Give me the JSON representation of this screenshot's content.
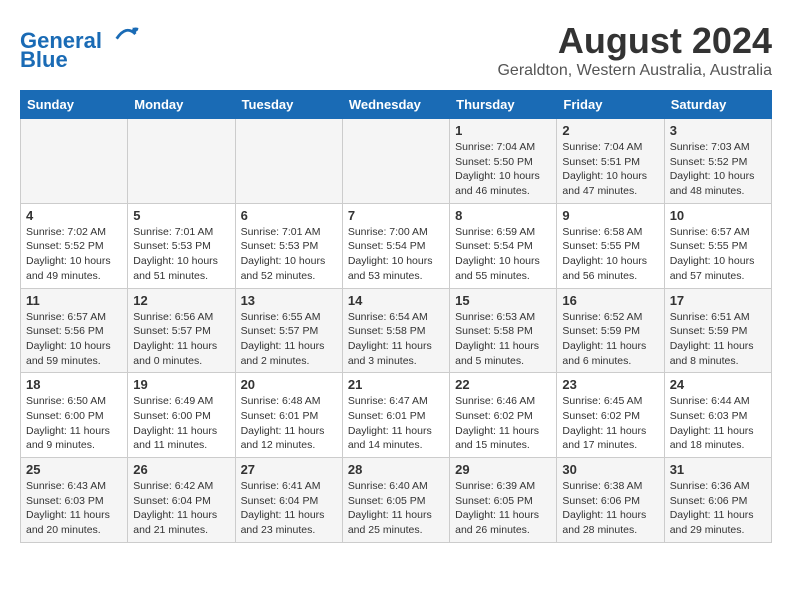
{
  "logo": {
    "line1": "General",
    "line2": "Blue"
  },
  "title": "August 2024",
  "subtitle": "Geraldton, Western Australia, Australia",
  "days_of_week": [
    "Sunday",
    "Monday",
    "Tuesday",
    "Wednesday",
    "Thursday",
    "Friday",
    "Saturday"
  ],
  "weeks": [
    [
      {
        "day": "",
        "info": ""
      },
      {
        "day": "",
        "info": ""
      },
      {
        "day": "",
        "info": ""
      },
      {
        "day": "",
        "info": ""
      },
      {
        "day": "1",
        "info": "Sunrise: 7:04 AM\nSunset: 5:50 PM\nDaylight: 10 hours and 46 minutes."
      },
      {
        "day": "2",
        "info": "Sunrise: 7:04 AM\nSunset: 5:51 PM\nDaylight: 10 hours and 47 minutes."
      },
      {
        "day": "3",
        "info": "Sunrise: 7:03 AM\nSunset: 5:52 PM\nDaylight: 10 hours and 48 minutes."
      }
    ],
    [
      {
        "day": "4",
        "info": "Sunrise: 7:02 AM\nSunset: 5:52 PM\nDaylight: 10 hours and 49 minutes."
      },
      {
        "day": "5",
        "info": "Sunrise: 7:01 AM\nSunset: 5:53 PM\nDaylight: 10 hours and 51 minutes."
      },
      {
        "day": "6",
        "info": "Sunrise: 7:01 AM\nSunset: 5:53 PM\nDaylight: 10 hours and 52 minutes."
      },
      {
        "day": "7",
        "info": "Sunrise: 7:00 AM\nSunset: 5:54 PM\nDaylight: 10 hours and 53 minutes."
      },
      {
        "day": "8",
        "info": "Sunrise: 6:59 AM\nSunset: 5:54 PM\nDaylight: 10 hours and 55 minutes."
      },
      {
        "day": "9",
        "info": "Sunrise: 6:58 AM\nSunset: 5:55 PM\nDaylight: 10 hours and 56 minutes."
      },
      {
        "day": "10",
        "info": "Sunrise: 6:57 AM\nSunset: 5:55 PM\nDaylight: 10 hours and 57 minutes."
      }
    ],
    [
      {
        "day": "11",
        "info": "Sunrise: 6:57 AM\nSunset: 5:56 PM\nDaylight: 10 hours and 59 minutes."
      },
      {
        "day": "12",
        "info": "Sunrise: 6:56 AM\nSunset: 5:57 PM\nDaylight: 11 hours and 0 minutes."
      },
      {
        "day": "13",
        "info": "Sunrise: 6:55 AM\nSunset: 5:57 PM\nDaylight: 11 hours and 2 minutes."
      },
      {
        "day": "14",
        "info": "Sunrise: 6:54 AM\nSunset: 5:58 PM\nDaylight: 11 hours and 3 minutes."
      },
      {
        "day": "15",
        "info": "Sunrise: 6:53 AM\nSunset: 5:58 PM\nDaylight: 11 hours and 5 minutes."
      },
      {
        "day": "16",
        "info": "Sunrise: 6:52 AM\nSunset: 5:59 PM\nDaylight: 11 hours and 6 minutes."
      },
      {
        "day": "17",
        "info": "Sunrise: 6:51 AM\nSunset: 5:59 PM\nDaylight: 11 hours and 8 minutes."
      }
    ],
    [
      {
        "day": "18",
        "info": "Sunrise: 6:50 AM\nSunset: 6:00 PM\nDaylight: 11 hours and 9 minutes."
      },
      {
        "day": "19",
        "info": "Sunrise: 6:49 AM\nSunset: 6:00 PM\nDaylight: 11 hours and 11 minutes."
      },
      {
        "day": "20",
        "info": "Sunrise: 6:48 AM\nSunset: 6:01 PM\nDaylight: 11 hours and 12 minutes."
      },
      {
        "day": "21",
        "info": "Sunrise: 6:47 AM\nSunset: 6:01 PM\nDaylight: 11 hours and 14 minutes."
      },
      {
        "day": "22",
        "info": "Sunrise: 6:46 AM\nSunset: 6:02 PM\nDaylight: 11 hours and 15 minutes."
      },
      {
        "day": "23",
        "info": "Sunrise: 6:45 AM\nSunset: 6:02 PM\nDaylight: 11 hours and 17 minutes."
      },
      {
        "day": "24",
        "info": "Sunrise: 6:44 AM\nSunset: 6:03 PM\nDaylight: 11 hours and 18 minutes."
      }
    ],
    [
      {
        "day": "25",
        "info": "Sunrise: 6:43 AM\nSunset: 6:03 PM\nDaylight: 11 hours and 20 minutes."
      },
      {
        "day": "26",
        "info": "Sunrise: 6:42 AM\nSunset: 6:04 PM\nDaylight: 11 hours and 21 minutes."
      },
      {
        "day": "27",
        "info": "Sunrise: 6:41 AM\nSunset: 6:04 PM\nDaylight: 11 hours and 23 minutes."
      },
      {
        "day": "28",
        "info": "Sunrise: 6:40 AM\nSunset: 6:05 PM\nDaylight: 11 hours and 25 minutes."
      },
      {
        "day": "29",
        "info": "Sunrise: 6:39 AM\nSunset: 6:05 PM\nDaylight: 11 hours and 26 minutes."
      },
      {
        "day": "30",
        "info": "Sunrise: 6:38 AM\nSunset: 6:06 PM\nDaylight: 11 hours and 28 minutes."
      },
      {
        "day": "31",
        "info": "Sunrise: 6:36 AM\nSunset: 6:06 PM\nDaylight: 11 hours and 29 minutes."
      }
    ]
  ]
}
